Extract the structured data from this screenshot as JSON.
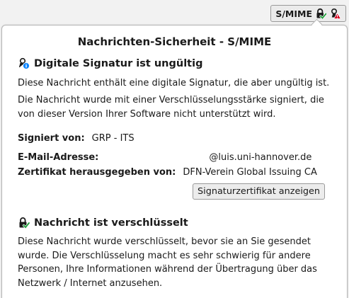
{
  "toolbar": {
    "smime_button_label": "S/MIME"
  },
  "panel": {
    "title": "Nachrichten-Sicherheit - S/MIME",
    "signature": {
      "heading": "Digitale Signatur ist ungültig",
      "description_line1": "Diese Nachricht enthält eine digitale Signatur, die aber ungültig ist.",
      "description_line2": "Die Nachricht wurde mit einer Verschlüsselungsstärke signiert, die von dieser Version Ihrer Software nicht unterstützt wird.",
      "signed_by_label": "Signiert von:",
      "signed_by_value": "GRP - ITS",
      "email_label": "E-Mail-Adresse:",
      "email_value_visible": "@luis.uni-hannover.de",
      "issuer_label": "Zertifikat herausgegeben von:",
      "issuer_value": "DFN-Verein Global Issuing CA",
      "view_cert_button": "Signaturzertifikat anzeigen"
    },
    "encryption": {
      "heading": "Nachricht ist verschlüsselt",
      "description": "Diese Nachricht wurde verschlüsselt, bevor sie an Sie gesendet wurde. Die Verschlüsselung macht es sehr schwierig für andere Personen, Ihre Informationen während der Übertragung über das Netzwerk / Internet anzusehen."
    }
  },
  "icons": {
    "lock_check": "lock-check-icon",
    "signature_warning": "signature-warning-icon",
    "signature_info": "signature-info-icon"
  },
  "colors": {
    "check_green": "#1e9e3a",
    "warning_red": "#d70022",
    "info_blue": "#0a84ff"
  }
}
